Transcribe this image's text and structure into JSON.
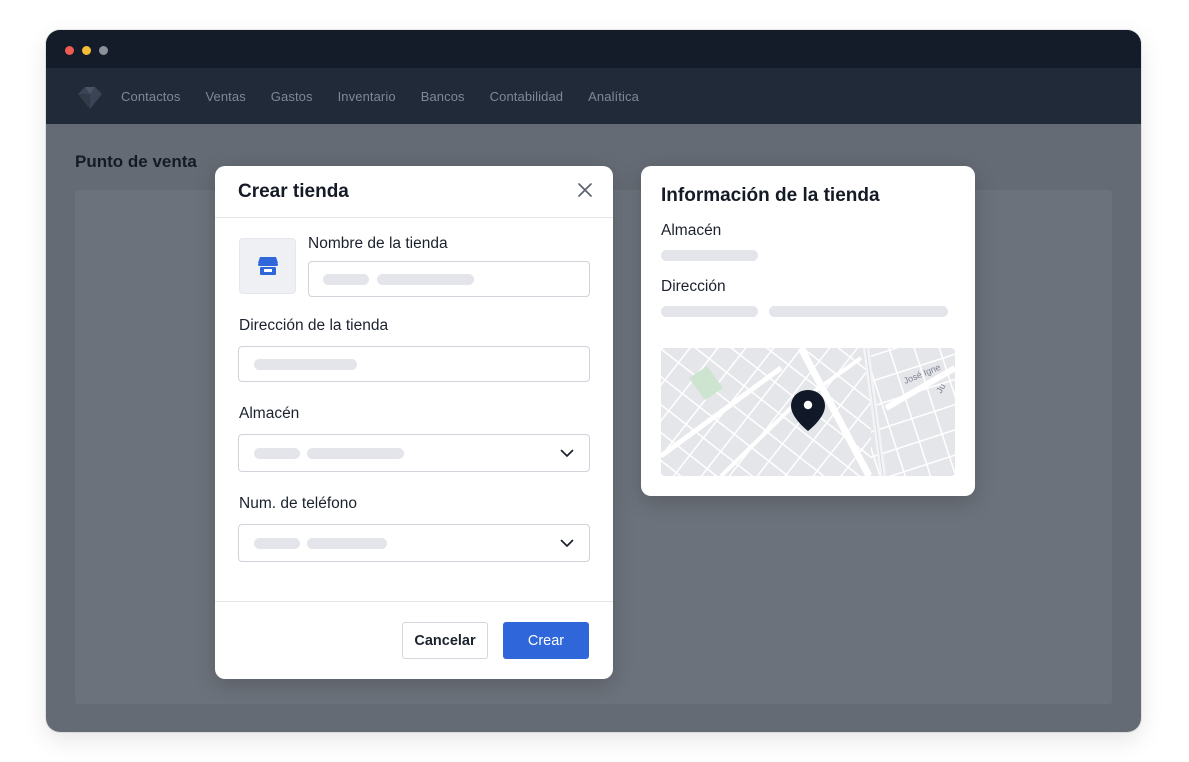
{
  "nav": {
    "items": [
      "Contactos",
      "Ventas",
      "Gastos",
      "Inventario",
      "Bancos",
      "Contabilidad",
      "Analítica"
    ]
  },
  "page": {
    "title": "Punto de venta"
  },
  "modal": {
    "title": "Crear tienda",
    "fields": {
      "store_name_label": "Nombre de la tienda",
      "store_address_label": "Dirección de la tienda",
      "warehouse_label": "Almacén",
      "phone_label": "Num. de teléfono"
    },
    "cancel_label": "Cancelar",
    "create_label": "Crear"
  },
  "info": {
    "title": "Información de la tienda",
    "warehouse_label": "Almacén",
    "address_label": "Dirección",
    "map_street_1": "José Igne",
    "map_street_2": "Ju"
  },
  "colors": {
    "accent": "#2f66d9",
    "titlebar": "#141b29",
    "navbar": "#212a39",
    "overlay": "#656b74"
  },
  "icons": {
    "logo": "diamond-logo-icon",
    "close": "close-icon",
    "store": "store-icon",
    "dropdown": "chevron-down-icon",
    "pin": "map-pin-icon"
  }
}
